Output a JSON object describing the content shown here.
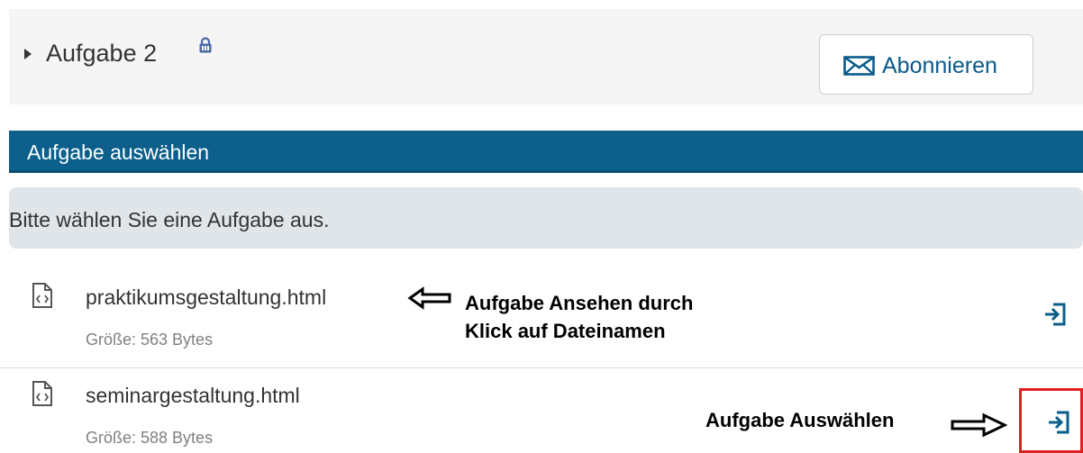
{
  "header": {
    "title": "Aufgabe 2",
    "subscribe_label": "Abonnieren"
  },
  "section": {
    "title": "Aufgabe auswählen"
  },
  "info": {
    "message": "Bitte wählen Sie eine Aufgabe aus."
  },
  "files": [
    {
      "name": "praktikumsgestaltung.html",
      "size": "Größe: 563 Bytes"
    },
    {
      "name": "seminargestaltung.html",
      "size": "Größe: 588 Bytes"
    }
  ],
  "annotations": {
    "view_line1": "Aufgabe Ansehen durch",
    "view_line2": "Klick auf Dateinamen",
    "select": "Aufgabe Auswählen"
  },
  "colors": {
    "accent": "#0b5f8a",
    "info_background": "#dfe5e9",
    "highlight": "#e02020"
  },
  "icons": {
    "caret": "caret-right-icon",
    "lock": "lock-icon",
    "mail": "envelope-icon",
    "file": "file-code-icon",
    "select": "sign-in-icon"
  }
}
